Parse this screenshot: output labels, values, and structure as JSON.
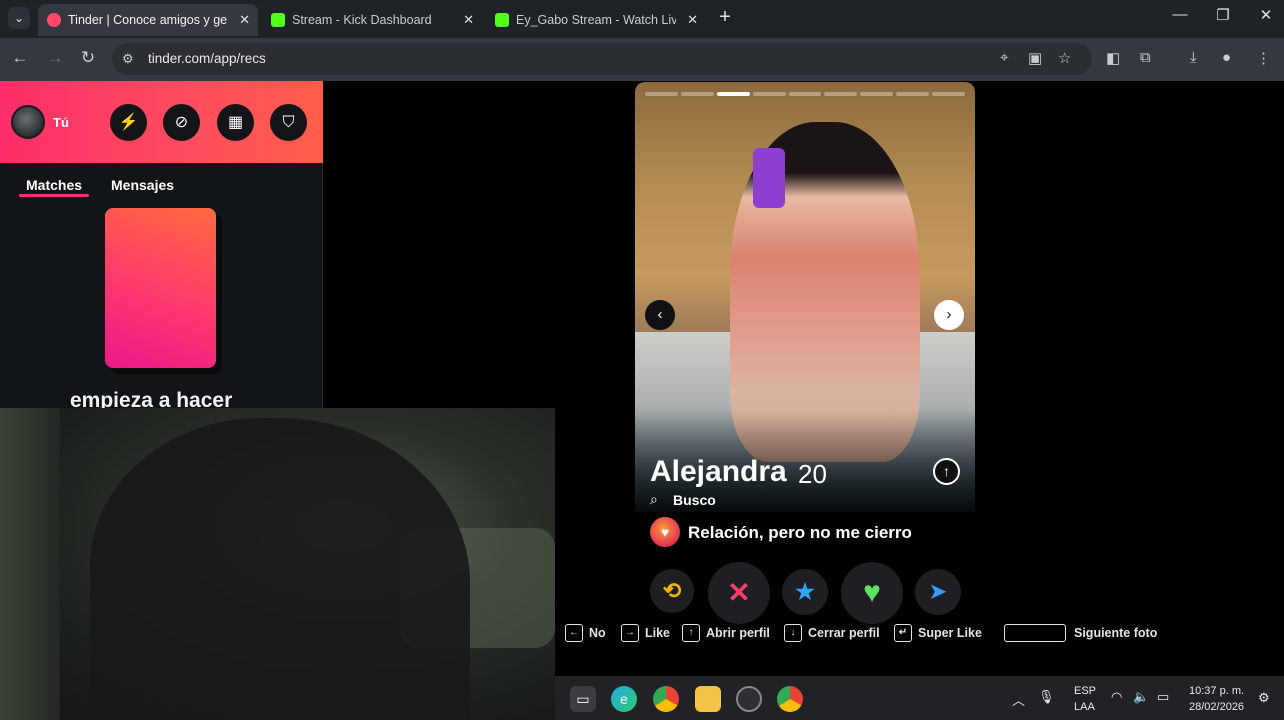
{
  "browser": {
    "tabs": [
      {
        "title": "Tinder | Conoce amigos y gente",
        "favicon_color": "#fd4a6a",
        "active": true
      },
      {
        "title": "Stream - Kick Dashboard",
        "favicon_color": "#53fc18",
        "active": false
      },
      {
        "title": "Ey_Gabo Stream - Watch Live o",
        "favicon_color": "#53fc18",
        "active": false
      }
    ],
    "new_tab": "+",
    "close": "✕",
    "url": "tinder.com/app/recs"
  },
  "sidebar": {
    "user_label": "Tú",
    "tabs": [
      "Matches",
      "Mensajes"
    ],
    "promo_text": "empieza a hacer",
    "accent": "#fd2e6b"
  },
  "profile": {
    "name": "Alejandra",
    "age": "20",
    "looking_for_label": "Busco",
    "relationship": "Relación, pero no me cierro",
    "photo_count": 9,
    "current_photo": 3
  },
  "actions": [
    {
      "name": "rewind",
      "glyph": "⟲",
      "color": "#f5b300"
    },
    {
      "name": "nope",
      "glyph": "✕",
      "color": "#ff3b6b"
    },
    {
      "name": "super-like",
      "glyph": "★",
      "color": "#2ea6ff"
    },
    {
      "name": "like",
      "glyph": "♥",
      "color": "#5fe25f"
    },
    {
      "name": "boost",
      "glyph": "➤",
      "color": "#3a9bff"
    }
  ],
  "shortcuts": [
    {
      "key": "←",
      "label": "No"
    },
    {
      "key": "→",
      "label": "Like"
    },
    {
      "key": "↑",
      "label": "Abrir perfil"
    },
    {
      "key": "↓",
      "label": "Cerrar perfil"
    },
    {
      "key": "↵",
      "label": "Super Like"
    },
    {
      "key": "",
      "label": "Siguiente foto"
    }
  ],
  "taskbar": {
    "lang_top": "ESP",
    "lang_bottom": "LAA",
    "time": "10:37 p. m.",
    "date": "28/02/2026"
  }
}
